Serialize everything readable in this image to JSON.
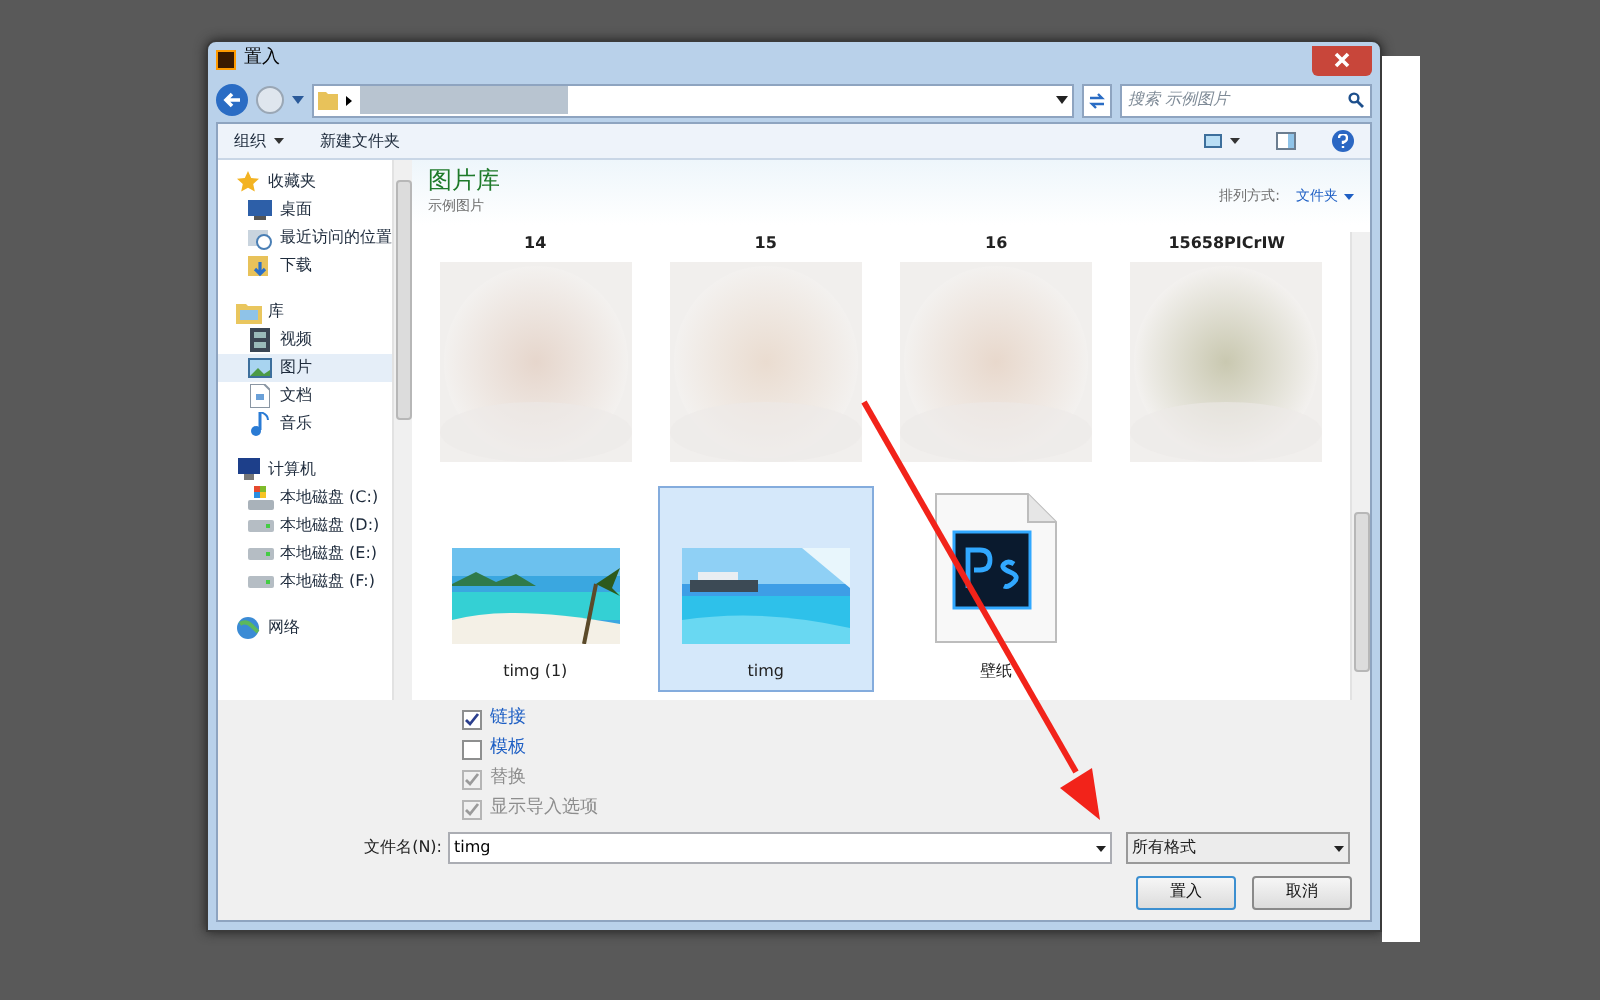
{
  "window": {
    "title": "置入"
  },
  "search": {
    "placeholder": "搜索 示例图片"
  },
  "toolbar": {
    "organize": "组织",
    "new_folder": "新建文件夹"
  },
  "sidebar": {
    "groups": [
      {
        "label": "收藏夹",
        "children": [
          {
            "label": "桌面",
            "selected": false
          },
          {
            "label": "最近访问的位置",
            "selected": false
          },
          {
            "label": "下载",
            "selected": false
          }
        ]
      },
      {
        "label": "库",
        "children": [
          {
            "label": "视频",
            "selected": false
          },
          {
            "label": "图片",
            "selected": true
          },
          {
            "label": "文档",
            "selected": false
          },
          {
            "label": "音乐",
            "selected": false
          }
        ]
      },
      {
        "label": "计算机",
        "children": [
          {
            "label": "本地磁盘 (C:)",
            "selected": false
          },
          {
            "label": "本地磁盘 (D:)",
            "selected": false
          },
          {
            "label": "本地磁盘 (E:)",
            "selected": false
          },
          {
            "label": "本地磁盘 (F:)",
            "selected": false
          }
        ]
      },
      {
        "label": "网络"
      }
    ]
  },
  "library": {
    "title": "图片库",
    "subtitle": "示例图片",
    "sort_label": "排列方式:",
    "sort_value": "文件夹"
  },
  "files": [
    {
      "name": "14",
      "kind": "blur",
      "selected": false,
      "color": "#e6d6cc"
    },
    {
      "name": "15",
      "kind": "blur",
      "selected": false,
      "color": "#eadcd0"
    },
    {
      "name": "16",
      "kind": "blur",
      "selected": false,
      "color": "#e8d8cc"
    },
    {
      "name": "15658PICrIW",
      "kind": "blur",
      "selected": false,
      "color": "#c9c8b0"
    },
    {
      "name": "timg (1)",
      "kind": "beach",
      "selected": false
    },
    {
      "name": "timg",
      "kind": "pool",
      "selected": true
    },
    {
      "name": "壁纸",
      "kind": "psd",
      "selected": false
    }
  ],
  "options": [
    {
      "label": "链接",
      "checked": true,
      "disabled": false
    },
    {
      "label": "模板",
      "checked": false,
      "disabled": false
    },
    {
      "label": "替换",
      "checked": true,
      "disabled": true
    },
    {
      "label": "显示导入选项",
      "checked": true,
      "disabled": true
    }
  ],
  "filename": {
    "label": "文件名(N):",
    "value": "timg"
  },
  "filetype": {
    "value": "所有格式"
  },
  "buttons": [
    {
      "label": "置入",
      "kind": "primary"
    },
    {
      "label": "取消",
      "kind": "cancel"
    }
  ]
}
